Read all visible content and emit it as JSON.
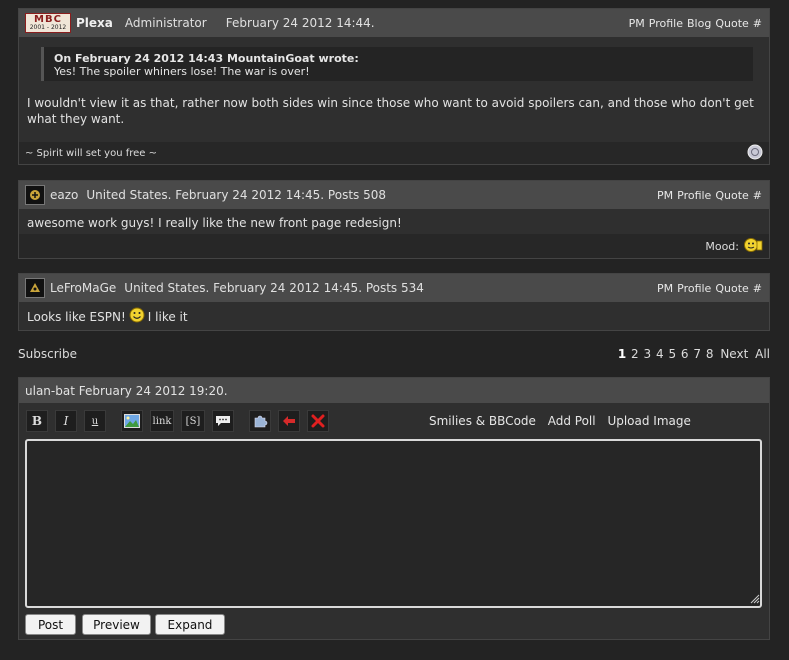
{
  "posts": [
    {
      "avatar_text": "MBC",
      "avatar_sub": "2001 - 2012",
      "username": "Plexa",
      "meta": "Administrator     February 24 2012 14:44.",
      "actions": [
        "PM",
        "Profile",
        "Blog",
        "Quote",
        "#"
      ],
      "quote_header": "On February 24 2012 14:43 MountainGoat wrote:",
      "quote_text": "Yes! The spoiler whiners lose! The war is over!",
      "body": "I wouldn't view it as that, rather now both sides win since those who want to avoid spoilers can, and those who don't get what they want.",
      "signature": "~ Spirit will set you free ~"
    },
    {
      "username": "eazo",
      "meta": "United States. February 24 2012 14:45. Posts 508",
      "actions": [
        "PM",
        "Profile",
        "Quote",
        "#"
      ],
      "body": "awesome work guys! I really like the new front page redesign!",
      "mood_label": "Mood:"
    },
    {
      "username": "LeFroMaGe",
      "meta": "United States. February 24 2012 14:45. Posts 534",
      "actions": [
        "PM",
        "Profile",
        "Quote",
        "#"
      ],
      "body_before": "Looks like ESPN!",
      "body_after": "I like it"
    }
  ],
  "subscribe": "Subscribe",
  "pagination": {
    "pages": [
      "1",
      "2",
      "3",
      "4",
      "5",
      "6",
      "7",
      "8"
    ],
    "current": "1",
    "next": "Next",
    "all": "All"
  },
  "editor": {
    "header": "ulan-bat February 24 2012 19:20.",
    "toolbar": {
      "bold": "B",
      "italic": "I",
      "underline": "u",
      "link": "link",
      "spoiler": "[S]"
    },
    "links": [
      "Smilies & BBCode",
      "Add Poll",
      "Upload Image"
    ],
    "textarea_value": "",
    "buttons": {
      "post": "Post",
      "preview": "Preview",
      "expand": "Expand"
    }
  }
}
